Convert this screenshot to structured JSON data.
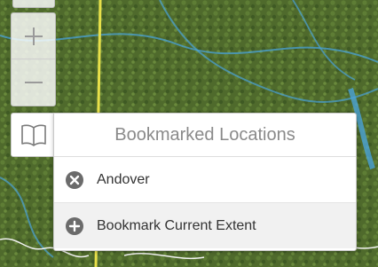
{
  "map": {
    "description_icon": "satellite-imagery"
  },
  "zoom": {
    "in_symbol": "+",
    "out_symbol": "−"
  },
  "bookmarks": {
    "toggle_icon": "book-icon",
    "title": "Bookmarked Locations",
    "items": [
      {
        "label": "Andover",
        "icon": "remove-circle-icon"
      }
    ],
    "add_label": "Bookmark Current Extent",
    "add_icon": "add-circle-icon"
  },
  "colors": {
    "road_yellow": "#e8e04a",
    "stream_blue": "#4aa3d8",
    "panel_text": "#333333",
    "title_grey": "#8a8a8a"
  }
}
